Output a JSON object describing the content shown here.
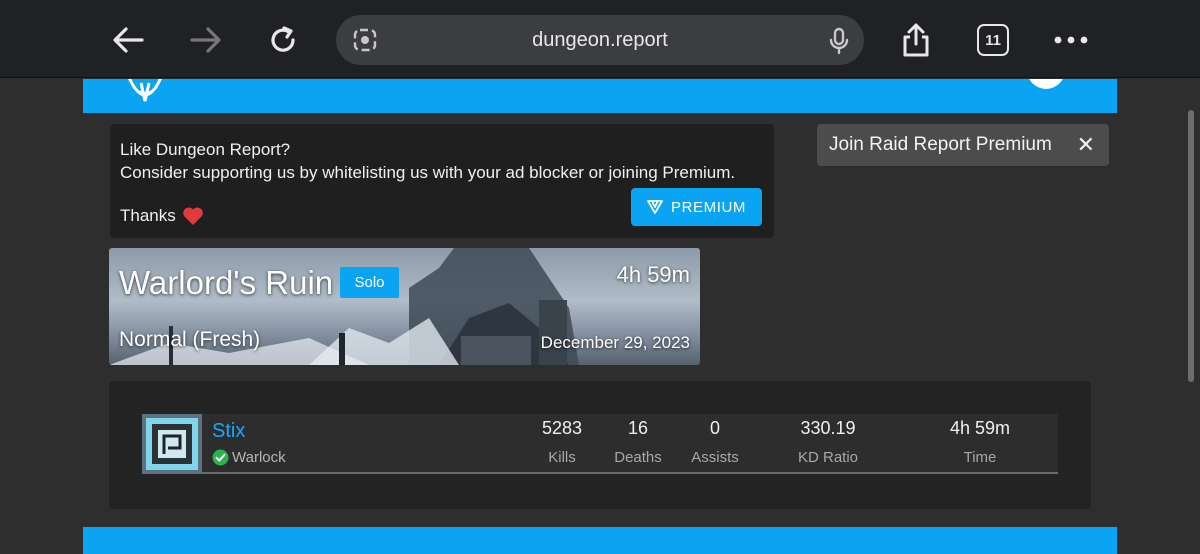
{
  "browser": {
    "url": "dungeon.report",
    "tab_count": "11"
  },
  "ad_notice": {
    "line1": "Like Dungeon Report?",
    "line2": "Consider supporting us by whitelisting us with your ad blocker or joining Premium.",
    "thanks": "Thanks",
    "premium_label": "PREMIUM"
  },
  "toast": {
    "text": "Join Raid Report Premium",
    "close": "✕"
  },
  "activity": {
    "name": "Warlord's Ruin",
    "badge": "Solo",
    "duration": "4h 59m",
    "difficulty": "Normal (Fresh)",
    "date": "December 29, 2023"
  },
  "player": {
    "name": "Stix",
    "class": "Warlock",
    "stats": [
      {
        "value": "5283",
        "label": "Kills"
      },
      {
        "value": "16",
        "label": "Deaths"
      },
      {
        "value": "0",
        "label": "Assists"
      },
      {
        "value": "330.19",
        "label": "KD Ratio"
      },
      {
        "value": "4h 59m",
        "label": "Time"
      }
    ]
  },
  "colors": {
    "accent": "#0aa4f2",
    "panel": "#232323",
    "background": "#2e2e2e",
    "success": "#2bb24c"
  }
}
